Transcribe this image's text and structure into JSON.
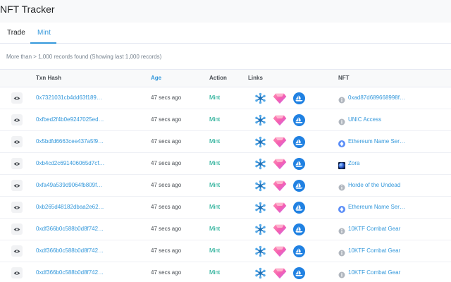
{
  "app": {
    "title": "NFT Tracker"
  },
  "tabs": [
    {
      "label": "Trade"
    },
    {
      "label": "Mint"
    }
  ],
  "summary": "More than > 1,000 records found (Showing last 1,000 records)",
  "table": {
    "columns": {
      "hash": "Txn Hash",
      "age": "Age",
      "action": "Action",
      "links": "Links",
      "nft": "NFT"
    },
    "rows": [
      {
        "hash": "0x7321031cb4dd63f189…",
        "age": "47 secs ago",
        "action": "Mint",
        "nft": "0xad87d689668998f…",
        "nft_icon": "info-circle-icon"
      },
      {
        "hash": "0xfbed2f4b0e9247025ed…",
        "age": "47 secs ago",
        "action": "Mint",
        "nft": "UNIC Access",
        "nft_icon": "info-circle-icon"
      },
      {
        "hash": "0x5bdfd6663cee437a5f9…",
        "age": "47 secs ago",
        "action": "Mint",
        "nft": "Ethereum Name Ser…",
        "nft_icon": "ens-icon"
      },
      {
        "hash": "0xb4cd2c691406065d7cf…",
        "age": "47 secs ago",
        "action": "Mint",
        "nft": "Zora",
        "nft_icon": "zora-icon"
      },
      {
        "hash": "0xfa49a539d9064fb809f…",
        "age": "47 secs ago",
        "action": "Mint",
        "nft": "Horde of the Undead",
        "nft_icon": "info-circle-icon"
      },
      {
        "hash": "0xb265d48182dbaa2e62…",
        "age": "47 secs ago",
        "action": "Mint",
        "nft": "Ethereum Name Ser…",
        "nft_icon": "ens-icon"
      },
      {
        "hash": "0xdf366b0c588b0d8f742…",
        "age": "47 secs ago",
        "action": "Mint",
        "nft": "10KTF Combat Gear",
        "nft_icon": "info-circle-icon"
      },
      {
        "hash": "0xdf366b0c588b0d8f742…",
        "age": "47 secs ago",
        "action": "Mint",
        "nft": "10KTF Combat Gear",
        "nft_icon": "info-circle-icon"
      },
      {
        "hash": "0xdf366b0c588b0d8f742…",
        "age": "47 secs ago",
        "action": "Mint",
        "nft": "10KTF Combat Gear",
        "nft_icon": "info-circle-icon"
      }
    ]
  },
  "colors": {
    "link": "#3498db",
    "mint": "#00a186",
    "header_bg": "#f8f9fa"
  }
}
